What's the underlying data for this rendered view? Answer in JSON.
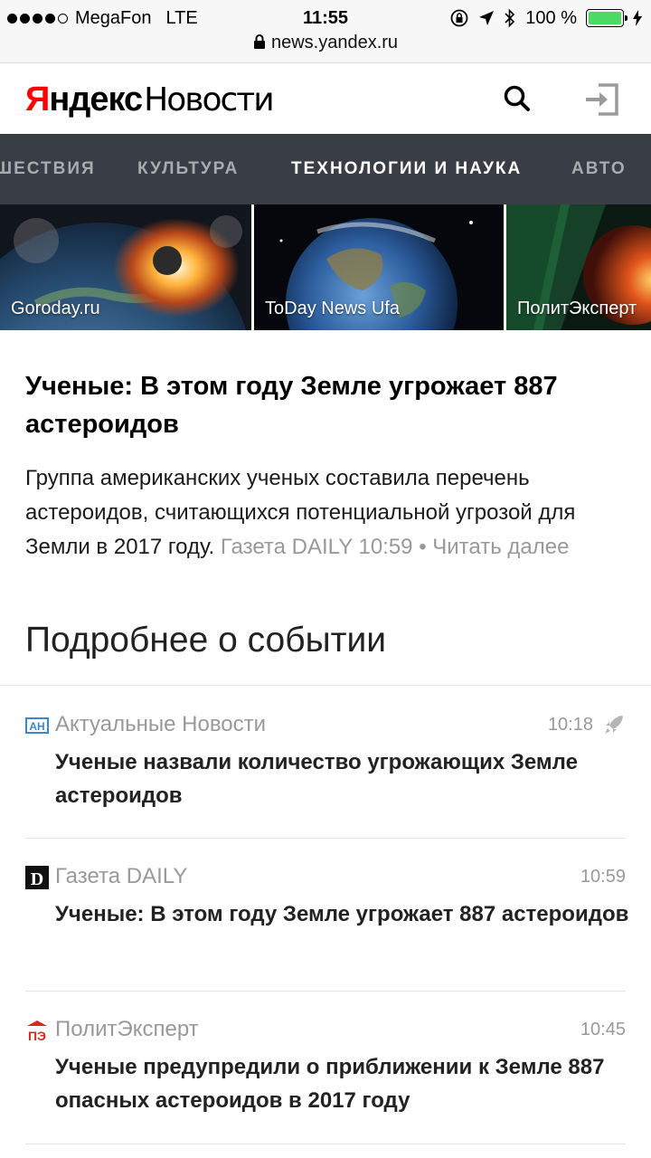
{
  "status_bar": {
    "carrier": "MegaFon",
    "network": "LTE",
    "time": "11:55",
    "battery": "100 %",
    "url": "news.yandex.ru"
  },
  "header": {
    "logo_ya": "Я",
    "logo_ndex": "ндекс",
    "logo_news": "Новости",
    "search_icon": "search-icon",
    "login_icon": "login-icon"
  },
  "tabs": [
    {
      "label": "ПУТЕШЕСТВИЯ",
      "shown": "ШЕСТВИЯ"
    },
    {
      "label": "КУЛЬТУРА"
    },
    {
      "label": "ТЕХНОЛОГИИ И НАУКА",
      "active": true
    },
    {
      "label": "АВТО"
    }
  ],
  "images": [
    {
      "caption": "Goroday.ru"
    },
    {
      "caption": "ToDay News Ufa"
    },
    {
      "caption": "ПолитЭксперт"
    }
  ],
  "article": {
    "headline": "Ученые: В этом году Земле угрожает 887 астероидов",
    "summary": "Группа американских ученых составила перечень астероидов, считающихся потенциальной угрозой для Земли в 2017 году.",
    "source": "Газета DAILY",
    "time": "10:59",
    "read_more": "• Читать далее"
  },
  "section_title": "Подробнее о событии",
  "related": [
    {
      "source": "Актуальные Новости",
      "time": "10:18",
      "title": "Ученые назвали количество угрожающих Земле астероидов",
      "logo": "АН"
    },
    {
      "source": "Газета DAILY",
      "time": "10:59",
      "title": "Ученые: В этом году Земле угрожает 887 астероидов",
      "logo": "D"
    },
    {
      "source": "ПолитЭксперт",
      "time": "10:45",
      "title": "Ученые предупредили о приближении к Земле 887 опасных астероидов в 2017 году",
      "logo": "ПЭ"
    }
  ],
  "colors": {
    "tabs_bg": "#393e46",
    "tab_inactive": "#a7acb3",
    "brand_red": "#ff0000",
    "battery": "#4cd964",
    "meta_gray": "#999999"
  }
}
